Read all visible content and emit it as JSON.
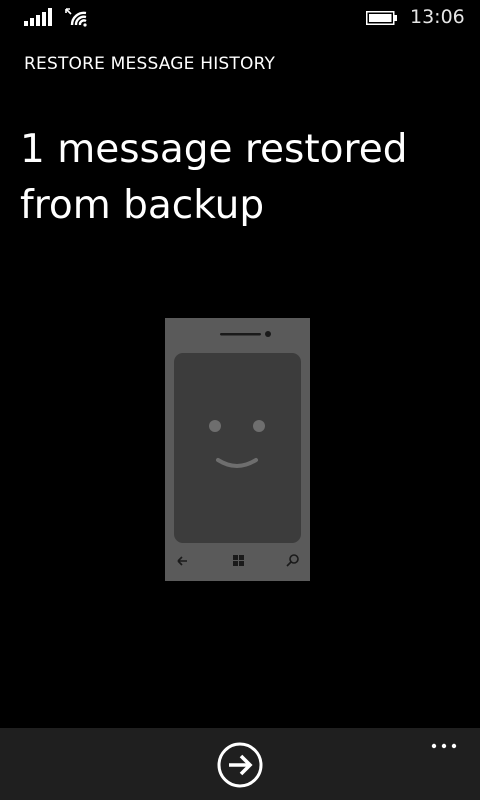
{
  "status_bar": {
    "time": "13:06",
    "icons": [
      "signal-strength-icon",
      "data-arrows-icon",
      "wifi-icon",
      "battery-icon"
    ]
  },
  "header": {
    "title": "RESTORE MESSAGE HISTORY"
  },
  "main": {
    "headline": "1 message restored from backup",
    "illustration": "smiling-phone-illustration"
  },
  "app_bar": {
    "primary_action_icon": "arrow-right-circle-icon",
    "more_icon": "ellipsis-icon"
  },
  "colors": {
    "background": "#000000",
    "text": "#ffffff",
    "app_bar": "#1f1f1f",
    "illustration_body": "#5a5a5a",
    "illustration_screen": "#3c3c3c"
  }
}
